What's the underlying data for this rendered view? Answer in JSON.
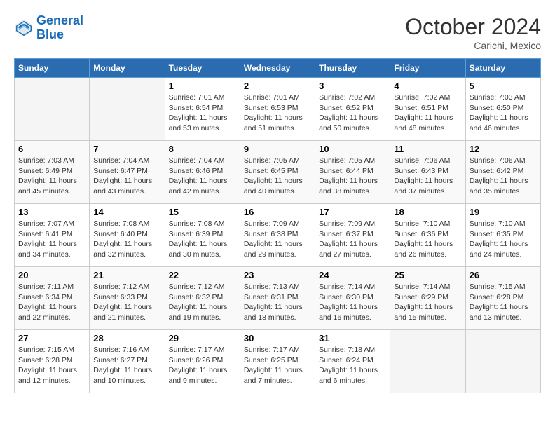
{
  "header": {
    "logo_line1": "General",
    "logo_line2": "Blue",
    "month": "October 2024",
    "location": "Carichi, Mexico"
  },
  "weekdays": [
    "Sunday",
    "Monday",
    "Tuesday",
    "Wednesday",
    "Thursday",
    "Friday",
    "Saturday"
  ],
  "weeks": [
    [
      {
        "day": "",
        "info": ""
      },
      {
        "day": "",
        "info": ""
      },
      {
        "day": "1",
        "info": "Sunrise: 7:01 AM\nSunset: 6:54 PM\nDaylight: 11 hours and 53 minutes."
      },
      {
        "day": "2",
        "info": "Sunrise: 7:01 AM\nSunset: 6:53 PM\nDaylight: 11 hours and 51 minutes."
      },
      {
        "day": "3",
        "info": "Sunrise: 7:02 AM\nSunset: 6:52 PM\nDaylight: 11 hours and 50 minutes."
      },
      {
        "day": "4",
        "info": "Sunrise: 7:02 AM\nSunset: 6:51 PM\nDaylight: 11 hours and 48 minutes."
      },
      {
        "day": "5",
        "info": "Sunrise: 7:03 AM\nSunset: 6:50 PM\nDaylight: 11 hours and 46 minutes."
      }
    ],
    [
      {
        "day": "6",
        "info": "Sunrise: 7:03 AM\nSunset: 6:49 PM\nDaylight: 11 hours and 45 minutes."
      },
      {
        "day": "7",
        "info": "Sunrise: 7:04 AM\nSunset: 6:47 PM\nDaylight: 11 hours and 43 minutes."
      },
      {
        "day": "8",
        "info": "Sunrise: 7:04 AM\nSunset: 6:46 PM\nDaylight: 11 hours and 42 minutes."
      },
      {
        "day": "9",
        "info": "Sunrise: 7:05 AM\nSunset: 6:45 PM\nDaylight: 11 hours and 40 minutes."
      },
      {
        "day": "10",
        "info": "Sunrise: 7:05 AM\nSunset: 6:44 PM\nDaylight: 11 hours and 38 minutes."
      },
      {
        "day": "11",
        "info": "Sunrise: 7:06 AM\nSunset: 6:43 PM\nDaylight: 11 hours and 37 minutes."
      },
      {
        "day": "12",
        "info": "Sunrise: 7:06 AM\nSunset: 6:42 PM\nDaylight: 11 hours and 35 minutes."
      }
    ],
    [
      {
        "day": "13",
        "info": "Sunrise: 7:07 AM\nSunset: 6:41 PM\nDaylight: 11 hours and 34 minutes."
      },
      {
        "day": "14",
        "info": "Sunrise: 7:08 AM\nSunset: 6:40 PM\nDaylight: 11 hours and 32 minutes."
      },
      {
        "day": "15",
        "info": "Sunrise: 7:08 AM\nSunset: 6:39 PM\nDaylight: 11 hours and 30 minutes."
      },
      {
        "day": "16",
        "info": "Sunrise: 7:09 AM\nSunset: 6:38 PM\nDaylight: 11 hours and 29 minutes."
      },
      {
        "day": "17",
        "info": "Sunrise: 7:09 AM\nSunset: 6:37 PM\nDaylight: 11 hours and 27 minutes."
      },
      {
        "day": "18",
        "info": "Sunrise: 7:10 AM\nSunset: 6:36 PM\nDaylight: 11 hours and 26 minutes."
      },
      {
        "day": "19",
        "info": "Sunrise: 7:10 AM\nSunset: 6:35 PM\nDaylight: 11 hours and 24 minutes."
      }
    ],
    [
      {
        "day": "20",
        "info": "Sunrise: 7:11 AM\nSunset: 6:34 PM\nDaylight: 11 hours and 22 minutes."
      },
      {
        "day": "21",
        "info": "Sunrise: 7:12 AM\nSunset: 6:33 PM\nDaylight: 11 hours and 21 minutes."
      },
      {
        "day": "22",
        "info": "Sunrise: 7:12 AM\nSunset: 6:32 PM\nDaylight: 11 hours and 19 minutes."
      },
      {
        "day": "23",
        "info": "Sunrise: 7:13 AM\nSunset: 6:31 PM\nDaylight: 11 hours and 18 minutes."
      },
      {
        "day": "24",
        "info": "Sunrise: 7:14 AM\nSunset: 6:30 PM\nDaylight: 11 hours and 16 minutes."
      },
      {
        "day": "25",
        "info": "Sunrise: 7:14 AM\nSunset: 6:29 PM\nDaylight: 11 hours and 15 minutes."
      },
      {
        "day": "26",
        "info": "Sunrise: 7:15 AM\nSunset: 6:28 PM\nDaylight: 11 hours and 13 minutes."
      }
    ],
    [
      {
        "day": "27",
        "info": "Sunrise: 7:15 AM\nSunset: 6:28 PM\nDaylight: 11 hours and 12 minutes."
      },
      {
        "day": "28",
        "info": "Sunrise: 7:16 AM\nSunset: 6:27 PM\nDaylight: 11 hours and 10 minutes."
      },
      {
        "day": "29",
        "info": "Sunrise: 7:17 AM\nSunset: 6:26 PM\nDaylight: 11 hours and 9 minutes."
      },
      {
        "day": "30",
        "info": "Sunrise: 7:17 AM\nSunset: 6:25 PM\nDaylight: 11 hours and 7 minutes."
      },
      {
        "day": "31",
        "info": "Sunrise: 7:18 AM\nSunset: 6:24 PM\nDaylight: 11 hours and 6 minutes."
      },
      {
        "day": "",
        "info": ""
      },
      {
        "day": "",
        "info": ""
      }
    ]
  ]
}
